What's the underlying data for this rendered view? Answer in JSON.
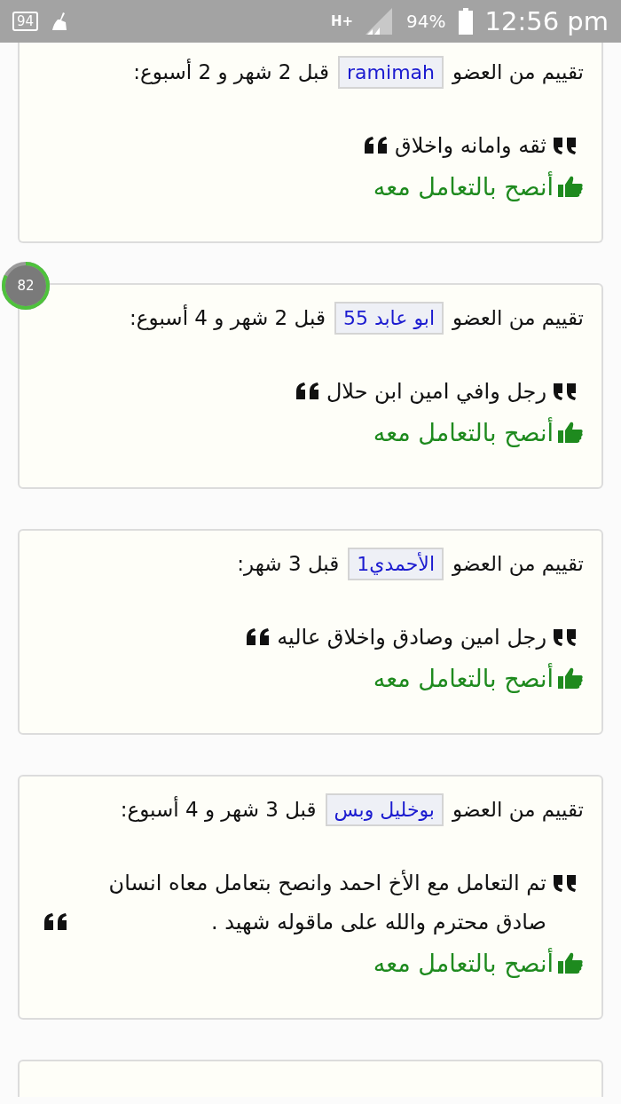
{
  "status_bar": {
    "notification": "94",
    "network": "H+",
    "battery": "94%",
    "time": "12:56 pm"
  },
  "progress_badge": {
    "label": "82",
    "level": 0.82
  },
  "reviews": [
    {
      "prefix": "تقييم من العضو",
      "member": "ramimah",
      "suffix": "قبل 2 شهر و 2 أسبوع:",
      "quote": "ثقه وامانه واخلاق",
      "recommend": "أنصح بالتعامل معه"
    },
    {
      "prefix": "تقييم من العضو",
      "member": "ابو عابد 55",
      "suffix": "قبل 2 شهر و 4 أسبوع:",
      "quote": "رجل وافي امين ابن حلال",
      "recommend": "أنصح بالتعامل معه"
    },
    {
      "prefix": "تقييم من العضو",
      "member": "الأحمدي1",
      "suffix": "قبل 3 شهر:",
      "quote": "رجل امين وصادق واخلاق عاليه",
      "recommend": "أنصح بالتعامل معه"
    },
    {
      "prefix": "تقييم من العضو",
      "member": "بوخليل وبس",
      "suffix": "قبل 3 شهر و 4 أسبوع:",
      "quote": "تم التعامل مع الأخ احمد وانصح بتعامل معاه انسان صادق محترم والله على ماقوله شهيد .",
      "recommend": "أنصح بالتعامل معه"
    }
  ]
}
